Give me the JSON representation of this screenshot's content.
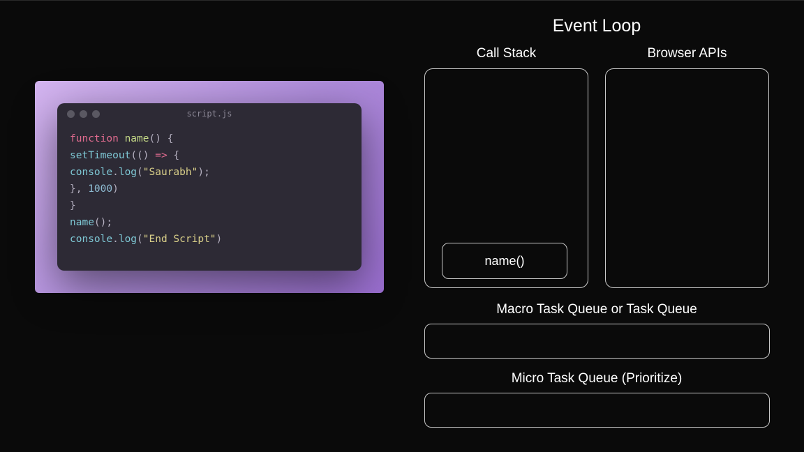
{
  "editor": {
    "filename": "script.js",
    "code": {
      "line1": {
        "kw_function": "function",
        "name": "name",
        "parens": "()",
        "brace": " {"
      },
      "line2": {
        "indent": "  ",
        "method": "setTimeout",
        "open": "(() ",
        "arrow": "=>",
        "brace": " {"
      },
      "line3": {
        "indent": "    ",
        "obj": "console",
        "dot": ".",
        "method": "log",
        "open": "(",
        "str": "\"Saurabh\"",
        "close": ");"
      },
      "line4": {
        "indent": "  ",
        "close": "}, ",
        "num": "1000",
        "paren": ")"
      },
      "line5": {
        "brace": "}"
      },
      "line6": {
        "name": "name",
        "call": "();"
      },
      "line7": {
        "obj": "console",
        "dot": ".",
        "method": "log",
        "open": "(",
        "str": "\"End Script\"",
        "close": ")"
      }
    }
  },
  "eventLoop": {
    "title": "Event Loop",
    "callStack": {
      "label": "Call Stack",
      "items": [
        "name()"
      ]
    },
    "browserApis": {
      "label": "Browser APIs"
    },
    "macroQueue": {
      "label": "Macro Task Queue or Task Queue"
    },
    "microQueue": {
      "label": "Micro Task Queue (Prioritize)"
    }
  }
}
